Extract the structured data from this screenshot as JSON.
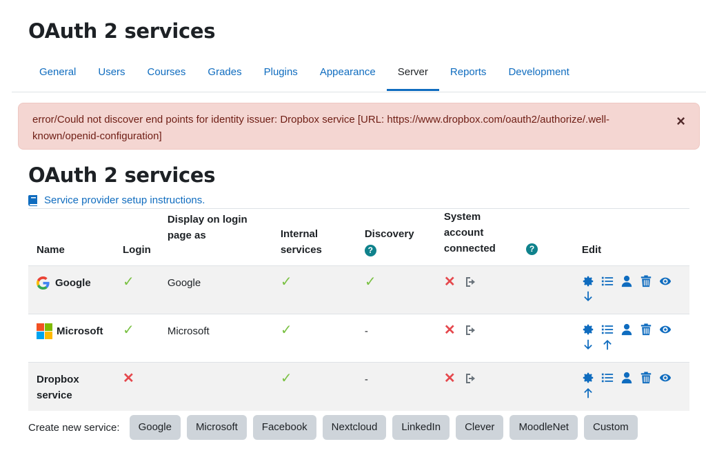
{
  "page": {
    "title": "OAuth 2 services",
    "heading": "OAuth 2 services"
  },
  "tabs": [
    {
      "label": "General"
    },
    {
      "label": "Users"
    },
    {
      "label": "Courses"
    },
    {
      "label": "Grades"
    },
    {
      "label": "Plugins"
    },
    {
      "label": "Appearance"
    },
    {
      "label": "Server",
      "active": true
    },
    {
      "label": "Reports"
    },
    {
      "label": "Development"
    }
  ],
  "alert": {
    "text": "error/Could not discover end points for identity issuer: Dropbox service [URL: https://www.dropbox.com/oauth2/authorize/.well-known/openid-configuration]",
    "close": "×"
  },
  "setup_link": "Service provider setup instructions.",
  "table": {
    "headers": {
      "name": "Name",
      "login": "Login",
      "display": "Display on login page as",
      "internal": "Internal services",
      "discovery": "Discovery",
      "system": "System account connected",
      "edit": "Edit"
    },
    "rows": [
      {
        "name": "Google",
        "display": "Google",
        "discovery": "✓"
      },
      {
        "name": "Microsoft",
        "display": "Microsoft",
        "discovery": "-"
      },
      {
        "name": "Dropbox service",
        "display": "",
        "discovery": "-"
      }
    ]
  },
  "create": {
    "label": "Create new service:",
    "buttons": [
      "Google",
      "Microsoft",
      "Facebook",
      "Nextcloud",
      "LinkedIn",
      "Clever",
      "MoodleNet",
      "Custom"
    ]
  },
  "colors": {
    "link": "#0f6cbf",
    "alert_bg": "#f4d6d2",
    "check": "#7ac143",
    "cross": "#e5484d",
    "help": "#0f828c"
  }
}
